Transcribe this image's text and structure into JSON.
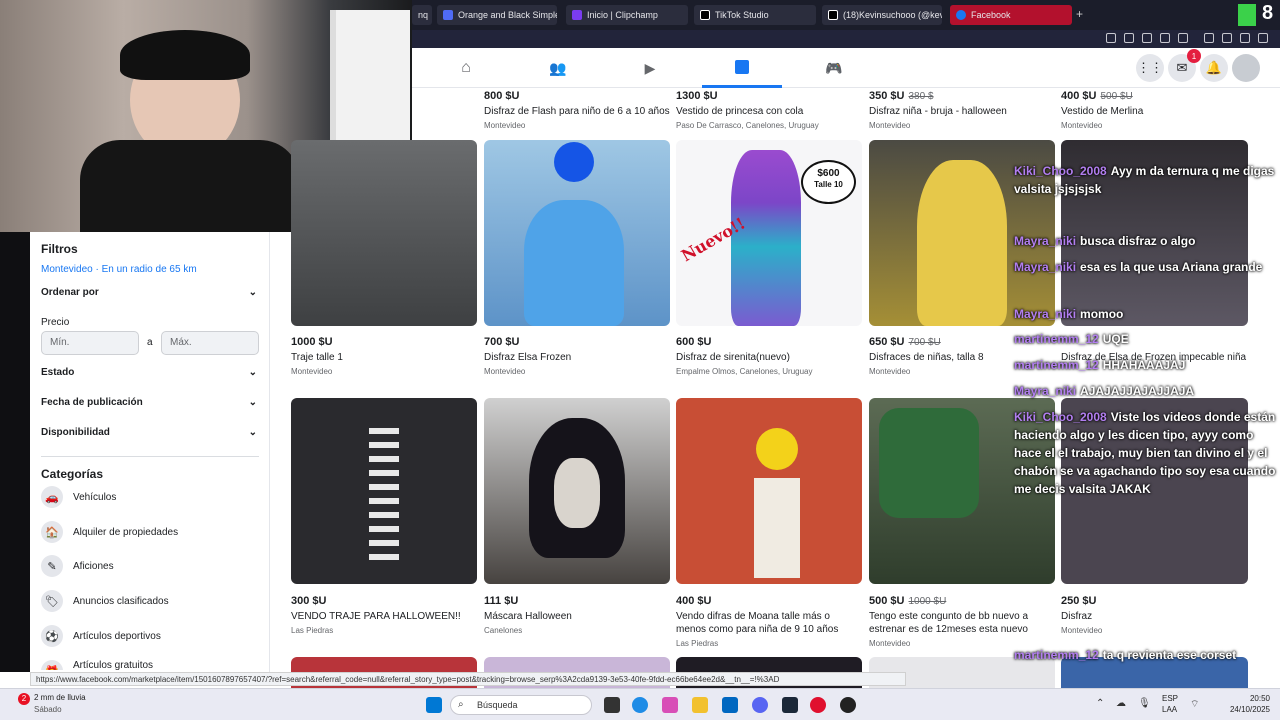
{
  "browser": {
    "tabs": [
      {
        "label": "nq",
        "icon": "tab-icon",
        "color": "#4a4c5c"
      },
      {
        "label": "Orange and Black Simple",
        "icon": "canva-icon",
        "color": "#4f6bf5"
      },
      {
        "label": "Inicio | Clipchamp",
        "icon": "clipchamp-icon",
        "color": "#7a3cf0"
      },
      {
        "label": "TikTok Studio",
        "icon": "tiktok-icon",
        "color": "#111"
      },
      {
        "label": "(18)Kevinsuchooo (@kev",
        "icon": "tiktok-icon",
        "color": "#111"
      },
      {
        "label": "Facebook",
        "icon": "facebook-icon",
        "color": "#1877f2"
      }
    ],
    "new_tab": "+",
    "status_url": "https://www.facebook.com/marketplace/item/1501607897657407/?ref=search&referral_code=null&referral_story_type=post&tracking=browse_serp%3A2cda9139-3e53-40fe-9fdd-ec66be64ee2d&__tn__=!%3AD"
  },
  "fbnav": {
    "notif_count": "1"
  },
  "sidebar": {
    "filters_title": "Filtros",
    "location": "Montevideo · En un radio de 65 km",
    "sort_label": "Ordenar por",
    "price_label": "Precio",
    "min_placeholder": "Mín.",
    "max_placeholder": "Máx.",
    "range_sep": "a",
    "state_label": "Estado",
    "date_label": "Fecha de publicación",
    "availability_label": "Disponibilidad",
    "categories_title": "Categorías",
    "categories": [
      {
        "label": "Vehículos",
        "icon": "car-icon"
      },
      {
        "label": "Alquiler de propiedades",
        "icon": "house-icon"
      },
      {
        "label": "Aficiones",
        "icon": "guitar-icon"
      },
      {
        "label": "Anuncios clasificados",
        "icon": "tag-icon"
      },
      {
        "label": "Artículos deportivos",
        "icon": "sports-icon"
      },
      {
        "label": "Artículos gratuitos",
        "icon": "gift-icon"
      }
    ]
  },
  "listings_top": [
    {
      "price": "800 $U",
      "old": "",
      "title": "Disfraz de Flash para niño de 6 a 10 años",
      "loc": "Montevideo"
    },
    {
      "price": "1300 $U",
      "old": "",
      "title": "Vestido de princesa con cola",
      "loc": "Paso De Carrasco, Canelones, Uruguay"
    },
    {
      "price": "350 $U",
      "old": "380 $",
      "title": "Disfraz niña - bruja - halloween",
      "loc": "Montevideo"
    },
    {
      "price": "400 $U",
      "old": "500 $U",
      "title": "Vestido de Merlina",
      "loc": "Montevideo"
    }
  ],
  "listings_row1": [
    {
      "price": "1000 $U",
      "old": "",
      "title": "Traje talle 1",
      "loc": "Montevideo",
      "img": "#5b5d5f"
    },
    {
      "price": "700 $U",
      "old": "",
      "title": "Disfraz Elsa Frozen",
      "loc": "Montevideo",
      "img": "#7fb0d8"
    },
    {
      "price": "600 $U",
      "old": "",
      "title": "Disfraz de sirenita(nuevo)",
      "loc": "Empalme Olmos, Canelones, Uruguay",
      "img": "#f4f4f6"
    },
    {
      "price": "650 $U",
      "old": "700 $U",
      "title": "Disfraces de niñas, talla 8",
      "loc": "Montevideo",
      "img": "#8a7a3a"
    },
    {
      "price": "",
      "old": "",
      "title": "Disfraz de Elsa de Frozen impecable niña",
      "loc": "",
      "img": "#3f3a40"
    }
  ],
  "listings_row2": [
    {
      "price": "300 $U",
      "old": "",
      "title": "VENDO TRAJE PARA HALLOWEEN!!",
      "loc": "Las Piedras",
      "img": "#2b2b30"
    },
    {
      "price": "111 $U",
      "old": "",
      "title": "Máscara Halloween",
      "loc": "Canelones",
      "img": "#3a3634"
    },
    {
      "price": "400 $U",
      "old": "",
      "title": "Vendo difras de Moana talle más o menos como para niña de 9 10 años",
      "loc": "Las Piedras",
      "img": "#c2503a"
    },
    {
      "price": "500 $U",
      "old": "1000 $U",
      "title": "Tengo este congunto de bb nuevo a estrenar es de 12meses esta nuevo",
      "loc": "Montevideo",
      "img": "#5f7a52"
    },
    {
      "price": "250 $U",
      "old": "",
      "title": "Disfraz",
      "loc": "Montevideo",
      "img": "#6a6470"
    }
  ],
  "mermaid_sign": {
    "line1": "$600",
    "line2": "Talle 10",
    "badge": "Nuevo!!"
  },
  "chat": [
    {
      "nick": "Kiki_Choo_2008",
      "text": "Ayy m da ternura q me digas valsita jsjsjsjsk"
    },
    {
      "nick": "Mayra_niki",
      "text": "busca disfraz o algo"
    },
    {
      "nick": "Mayra_niki",
      "text": "esa es la que usa Ariana grande"
    },
    {
      "nick": "Mayra_niki",
      "text": "momoo"
    },
    {
      "nick": "martinemm_12",
      "text": "UQE"
    },
    {
      "nick": "martinemm_12",
      "text": "HHAHAAAJAJ"
    },
    {
      "nick": "Mayra_niki",
      "text": "AJAJAJJAJAJJAJA"
    },
    {
      "nick": "Kiki_Choo_2008",
      "text": "Viste los videos donde están haciendo algo y les dicen tipo, ayyy como hace el el trabajo, muy bien tan divino el y el chabón se va agachando tipo soy esa cuando me decis valsita JAKAK"
    },
    {
      "nick": "martinemm_12",
      "text": "ta q revienta ese corset"
    }
  ],
  "taskbar": {
    "weather_count": "2",
    "weather": "2 mm de lluvia",
    "weather_day": "Sábado",
    "search": "Búsqueda",
    "lang": "ESP",
    "lang2": "LAA",
    "time": "20:50",
    "date": "24/10/2025"
  }
}
